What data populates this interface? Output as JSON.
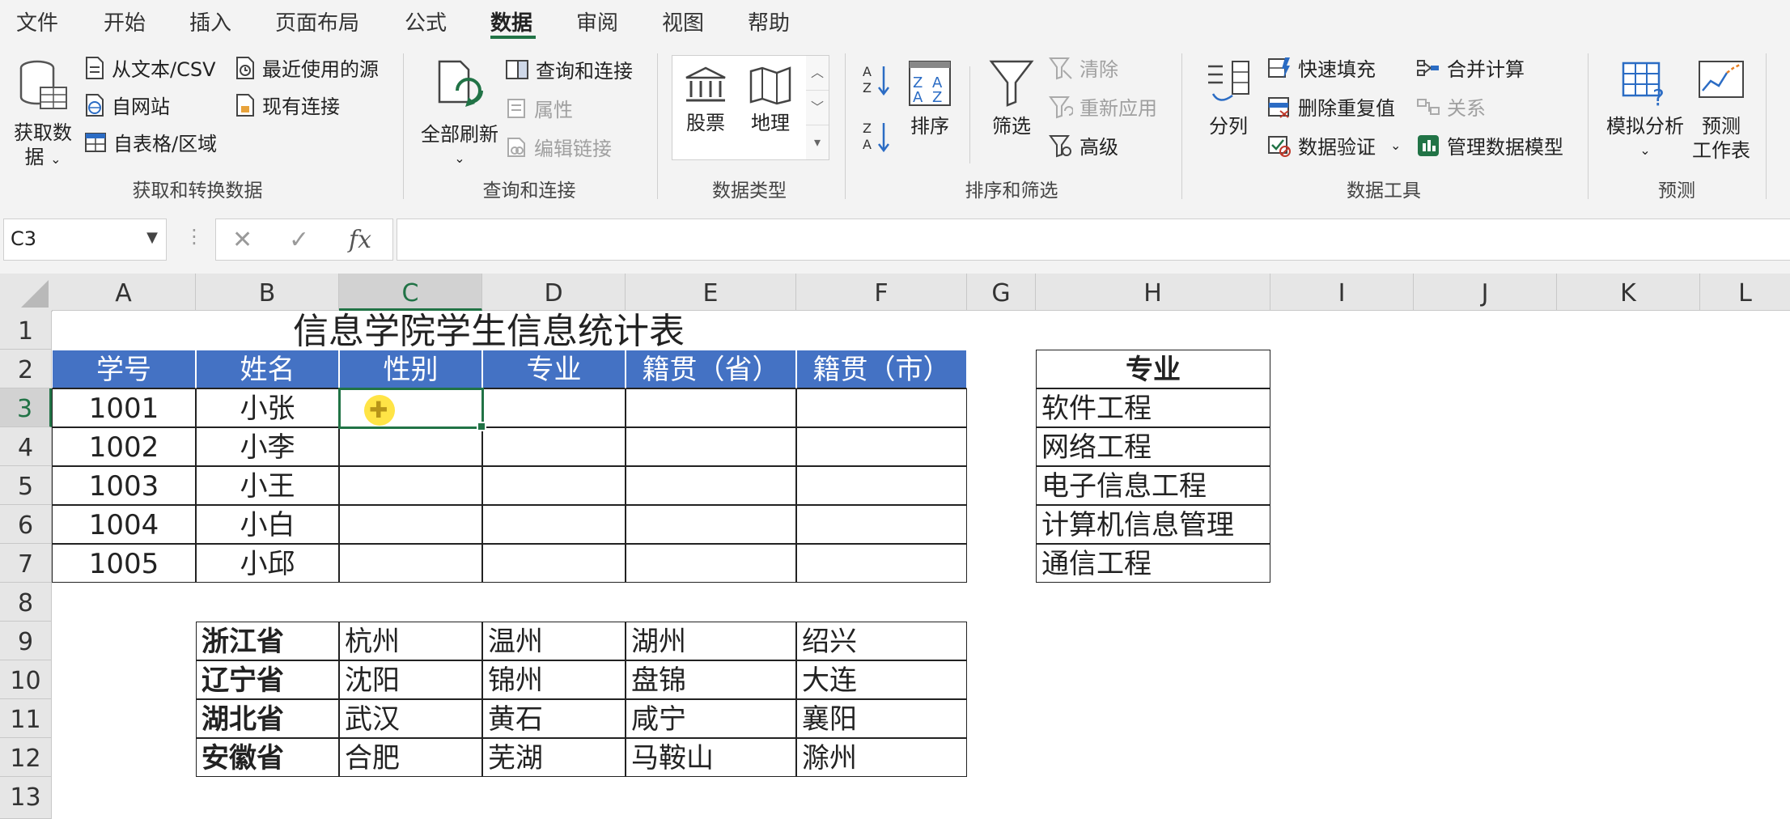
{
  "menu": {
    "tabs": [
      "文件",
      "开始",
      "插入",
      "页面布局",
      "公式",
      "数据",
      "审阅",
      "视图",
      "帮助"
    ],
    "active": "数据"
  },
  "ribbon": {
    "get_transform": {
      "get_data": "获取数据",
      "get_data_line1": "获取数",
      "get_data_line2": "据",
      "from_text": "从文本/CSV",
      "from_web": "自网站",
      "from_table": "自表格/区域",
      "recent_sources": "最近使用的源",
      "existing_connections": "现有连接",
      "label": "获取和转换数据"
    },
    "queries": {
      "refresh_all": "全部刷新",
      "queries_connections": "查询和连接",
      "properties": "属性",
      "edit_links": "编辑链接",
      "label": "查询和连接"
    },
    "data_types": {
      "stocks": "股票",
      "geography": "地理",
      "label": "数据类型"
    },
    "sort_filter": {
      "sort": "排序",
      "filter": "筛选",
      "clear": "清除",
      "reapply": "重新应用",
      "advanced": "高级",
      "label": "排序和筛选"
    },
    "data_tools": {
      "split": "分列",
      "flash_fill": "快速填充",
      "remove_duplicates": "删除重复值",
      "data_validation": "数据验证",
      "consolidate": "合并计算",
      "relationships": "关系",
      "manage_model": "管理数据模型",
      "label": "数据工具"
    },
    "forecast": {
      "what_if": "模拟分析",
      "forecast_sheet_line1": "预测",
      "forecast_sheet_line2": "工作表",
      "label": "预测"
    }
  },
  "formula_bar": {
    "name_box": "C3",
    "cancel_icon": "✕",
    "enter_icon": "✓",
    "fx": "fx",
    "content": ""
  },
  "grid": {
    "columns": [
      "A",
      "B",
      "C",
      "D",
      "E",
      "F",
      "G",
      "H",
      "I",
      "J",
      "K",
      "L"
    ],
    "rows": [
      "1",
      "2",
      "3",
      "4",
      "5",
      "6",
      "7",
      "8",
      "9",
      "10",
      "11",
      "12",
      "13"
    ],
    "selected_cell": "C3"
  },
  "sheet": {
    "title": "信息学院学生信息统计表",
    "headers": [
      "学号",
      "姓名",
      "性别",
      "专业",
      "籍贯（省）",
      "籍贯（市）"
    ],
    "students": [
      {
        "id": "1001",
        "name": "小张"
      },
      {
        "id": "1002",
        "name": "小李"
      },
      {
        "id": "1003",
        "name": "小王"
      },
      {
        "id": "1004",
        "name": "小白"
      },
      {
        "id": "1005",
        "name": "小邱"
      }
    ],
    "major_header": "专业",
    "majors": [
      "软件工程",
      "网络工程",
      "电子信息工程",
      "计算机信息管理",
      "通信工程"
    ],
    "provinces": [
      {
        "name": "浙江省",
        "cities": [
          "杭州",
          "温州",
          "湖州",
          "绍兴"
        ]
      },
      {
        "name": "辽宁省",
        "cities": [
          "沈阳",
          "锦州",
          "盘锦",
          "大连"
        ]
      },
      {
        "name": "湖北省",
        "cities": [
          "武汉",
          "黄石",
          "咸宁",
          "襄阳"
        ]
      },
      {
        "name": "安徽省",
        "cities": [
          "合肥",
          "芜湖",
          "马鞍山",
          "滁州"
        ]
      }
    ]
  },
  "colors": {
    "accent_green": "#217346",
    "header_blue": "#4472c4"
  }
}
